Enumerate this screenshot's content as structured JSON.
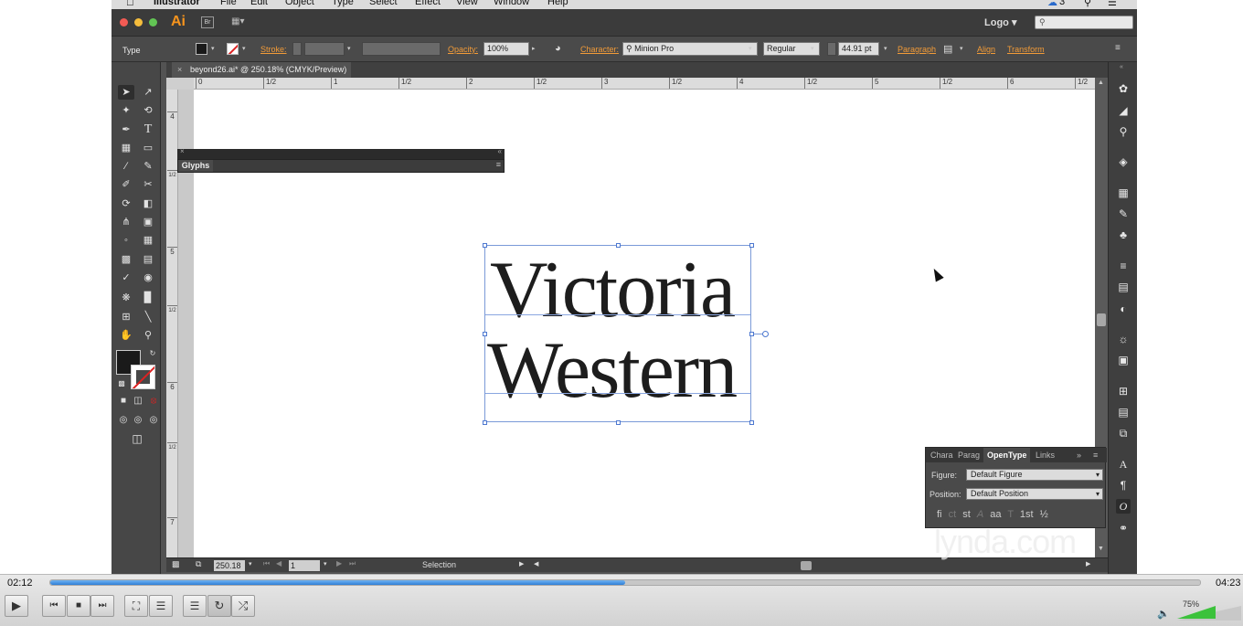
{
  "menubar": {
    "app_name": "Illustrator",
    "items": [
      "File",
      "Edit",
      "Object",
      "Type",
      "Select",
      "Effect",
      "View",
      "Window",
      "Help"
    ],
    "badge": "3"
  },
  "appbar": {
    "app_logo": "Ai",
    "bridge_label": "Br",
    "workspace": "Logo"
  },
  "controlbar": {
    "mode": "Type",
    "stroke_label": "Stroke:",
    "opacity_label": "Opacity:",
    "opacity_value": "100%",
    "character_label": "Character:",
    "font_family": "Minion Pro",
    "font_style": "Regular",
    "font_size": "44.91 pt",
    "paragraph_label": "Paragraph",
    "align_label": "Align",
    "transform_label": "Transform"
  },
  "document": {
    "tab_title": "beyond26.ai* @ 250.18% (CMYK/Preview)"
  },
  "rulers": {
    "top": [
      "0",
      "1/2",
      "1",
      "1/2",
      "2",
      "1/2",
      "3",
      "1/2",
      "4",
      "1/2",
      "5",
      "1/2",
      "6",
      "1/2"
    ],
    "left": [
      "4",
      "1/2",
      "5",
      "1/2",
      "6",
      "1/2",
      "7"
    ]
  },
  "glyphs_panel": {
    "tab": "Glyphs"
  },
  "artwork": {
    "line1": "Victoria",
    "line2": "Western"
  },
  "opentype_panel": {
    "tabs": [
      "Chara",
      "Parag",
      "OpenType",
      "Links"
    ],
    "active_tab": "OpenType",
    "figure_label": "Figure:",
    "figure_value": "Default Figure",
    "position_label": "Position:",
    "position_value": "Default Position",
    "feature_icons": [
      "fi",
      "ct",
      "st",
      "A",
      "aa",
      "T",
      "1st",
      "½"
    ]
  },
  "statusbar": {
    "zoom": "250.18",
    "page": "1",
    "tool": "Selection"
  },
  "watermark": "lynda.com",
  "player": {
    "elapsed": "02:12",
    "duration": "04:23",
    "progress_fraction": 0.5,
    "volume": "75%"
  },
  "colors": {
    "accent_orange": "#f29b38",
    "progress_blue": "#2f7fd6",
    "volume_green": "#3cc23c"
  }
}
